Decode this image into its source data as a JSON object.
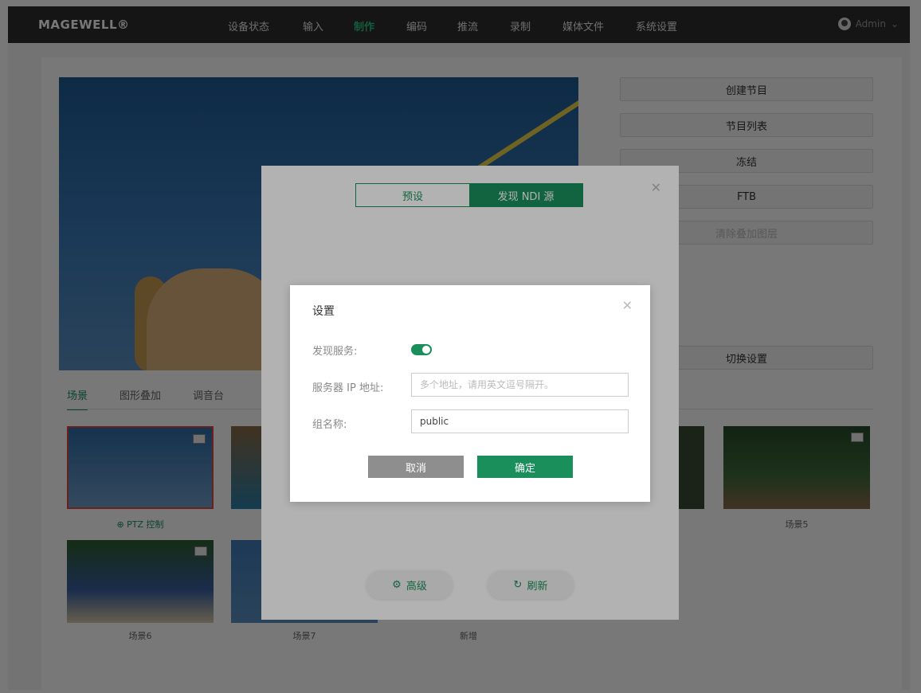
{
  "topbar": {
    "logo": "MAGEWELL®",
    "nav": [
      "设备状态",
      "输入",
      "制作",
      "编码",
      "推流",
      "录制",
      "媒体文件",
      "系统设置"
    ],
    "active_index": 2,
    "user": "Admin"
  },
  "right_panel": {
    "buttons": [
      "创建节目",
      "节目列表",
      "冻结",
      "FTB",
      "清除叠加图层"
    ],
    "switch_settings": "切换设置"
  },
  "lower_tabs": [
    "场景",
    "图形叠加",
    "调音台"
  ],
  "scenes": {
    "ptz": "PTZ 控制",
    "labels": [
      "场景5",
      "场景6",
      "场景7",
      "新增"
    ]
  },
  "ndi_modal": {
    "tab_preset": "预设",
    "tab_discover": "发现 NDI 源",
    "advanced": "高级",
    "refresh": "刷新"
  },
  "settings_dialog": {
    "title": "设置",
    "discovery_label": "发现服务:",
    "discovery_enabled": true,
    "server_ip_label": "服务器 IP 地址:",
    "server_ip_placeholder": "多个地址，请用英文逗号隔开。",
    "group_label": "组名称:",
    "group_value": "public",
    "cancel": "取消",
    "ok": "确定"
  },
  "colors": {
    "accent": "#1a8f5c",
    "topbar": "#2e2e2e"
  }
}
